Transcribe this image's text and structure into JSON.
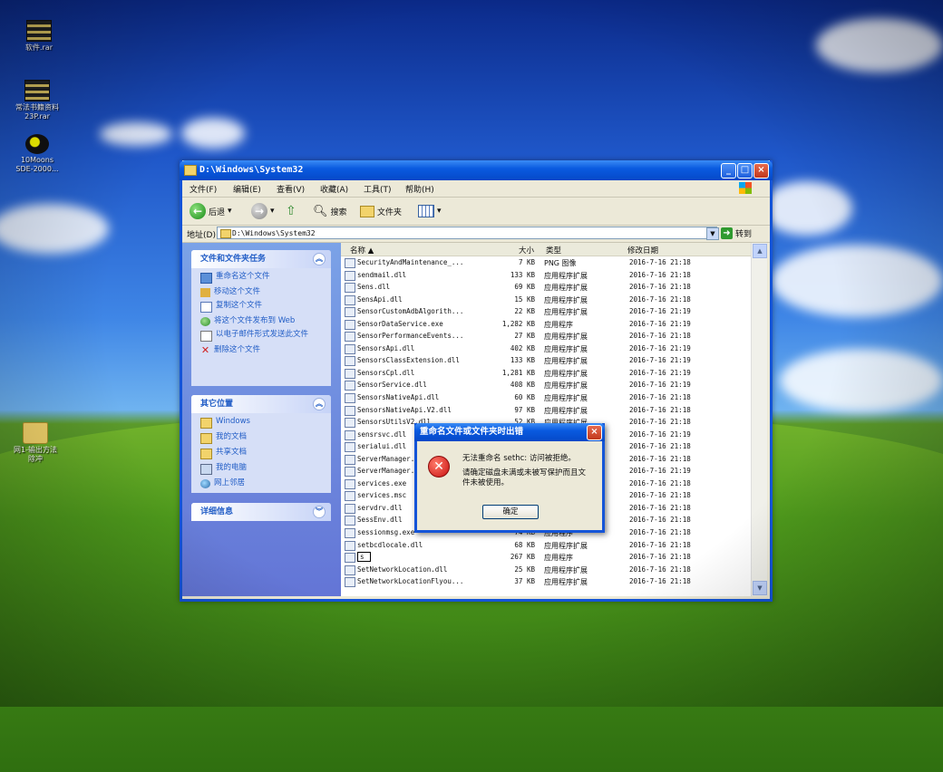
{
  "desktop": {
    "icons": [
      {
        "label": "软件.rar",
        "icon": "rar-archive-icon"
      },
      {
        "label": "常法书籍资料\n23P.rar",
        "icon": "rar-archive-icon"
      },
      {
        "label": "10Moons\nSDE-2000...",
        "icon": "app-icon"
      },
      {
        "label": "网1-输出方法\n除冲",
        "icon": "folder-icon"
      }
    ]
  },
  "window": {
    "title": "D:\\Windows\\System32",
    "menu": [
      "文件(F)",
      "编辑(E)",
      "查看(V)",
      "收藏(A)",
      "工具(T)",
      "帮助(H)"
    ],
    "toolbar": {
      "back": "后退",
      "search": "搜索",
      "folders": "文件夹"
    },
    "address": {
      "label": "地址(D)",
      "value": "D:\\Windows\\System32",
      "go": "转到"
    },
    "tasks_panel": {
      "title": "文件和文件夹任务",
      "items": [
        "重命名这个文件",
        "移动这个文件",
        "复制这个文件",
        "将这个文件发布到 Web",
        "以电子邮件形式发送此文件",
        "删除这个文件"
      ]
    },
    "places_panel": {
      "title": "其它位置",
      "items": [
        "Windows",
        "我的文档",
        "共享文档",
        "我的电脑",
        "网上邻居"
      ]
    },
    "details_panel": {
      "title": "详细信息"
    },
    "columns": {
      "name": "名称 ▲",
      "size": "大小",
      "type": "类型",
      "modified": "修改日期"
    },
    "files": [
      {
        "name": "SecurityAndMaintenance_...",
        "size": "7 KB",
        "type": "PNG 图像",
        "date": "2016-7-16 21:18"
      },
      {
        "name": "sendmail.dll",
        "size": "133 KB",
        "type": "应用程序扩展",
        "date": "2016-7-16 21:18"
      },
      {
        "name": "Sens.dll",
        "size": "69 KB",
        "type": "应用程序扩展",
        "date": "2016-7-16 21:18"
      },
      {
        "name": "SensApi.dll",
        "size": "15 KB",
        "type": "应用程序扩展",
        "date": "2016-7-16 21:18"
      },
      {
        "name": "SensorCustomAdbAlgorith...",
        "size": "22 KB",
        "type": "应用程序扩展",
        "date": "2016-7-16 21:19"
      },
      {
        "name": "SensorDataService.exe",
        "size": "1,282 KB",
        "type": "应用程序",
        "date": "2016-7-16 21:19"
      },
      {
        "name": "SensorPerformanceEvents...",
        "size": "27 KB",
        "type": "应用程序扩展",
        "date": "2016-7-16 21:18"
      },
      {
        "name": "SensorsApi.dll",
        "size": "402 KB",
        "type": "应用程序扩展",
        "date": "2016-7-16 21:19"
      },
      {
        "name": "SensorsClassExtension.dll",
        "size": "133 KB",
        "type": "应用程序扩展",
        "date": "2016-7-16 21:19"
      },
      {
        "name": "SensorsCpl.dll",
        "size": "1,281 KB",
        "type": "应用程序扩展",
        "date": "2016-7-16 21:19"
      },
      {
        "name": "SensorService.dll",
        "size": "408 KB",
        "type": "应用程序扩展",
        "date": "2016-7-16 21:19"
      },
      {
        "name": "SensorsNativeApi.dll",
        "size": "60 KB",
        "type": "应用程序扩展",
        "date": "2016-7-16 21:18"
      },
      {
        "name": "SensorsNativeApi.V2.dll",
        "size": "97 KB",
        "type": "应用程序扩展",
        "date": "2016-7-16 21:18"
      },
      {
        "name": "SensorsUtilsV2.dll",
        "size": "52 KB",
        "type": "应用程序扩展",
        "date": "2016-7-16 21:18"
      },
      {
        "name": "sensrsvc.dll",
        "size": "",
        "type": "",
        "date": "2016-7-16 21:19"
      },
      {
        "name": "serialui.dll",
        "size": "",
        "type": "",
        "date": "2016-7-16 21:18"
      },
      {
        "name": "ServerManager...",
        "size": "",
        "type": "",
        "date": "2016-7-16 21:18"
      },
      {
        "name": "ServerManager...",
        "size": "",
        "type": "",
        "date": "2016-7-16 21:19"
      },
      {
        "name": "services.exe",
        "size": "",
        "type": "",
        "date": "2016-7-16 21:18"
      },
      {
        "name": "services.msc",
        "size": "",
        "type": "",
        "date": "2016-7-16 21:18"
      },
      {
        "name": "servdrv.dll",
        "size": "",
        "type": "",
        "date": "2016-7-16 21:18"
      },
      {
        "name": "SessEnv.dll",
        "size": "",
        "type": "",
        "date": "2016-7-16 21:18"
      },
      {
        "name": "sessionmsg.exe",
        "size": "74 KB",
        "type": "应用程序",
        "date": "2016-7-16 21:18"
      },
      {
        "name": "setbcdlocale.dll",
        "size": "68 KB",
        "type": "应用程序扩展",
        "date": "2016-7-16 21:18"
      },
      {
        "name": "s",
        "size": "267 KB",
        "type": "应用程序",
        "date": "2016-7-16 21:18"
      },
      {
        "name": "SetNetworkLocation.dll",
        "size": "25 KB",
        "type": "应用程序扩展",
        "date": "2016-7-16 21:18"
      },
      {
        "name": "SetNetworkLocationFlyou...",
        "size": "37 KB",
        "type": "应用程序扩展",
        "date": "2016-7-16 21:18"
      }
    ]
  },
  "dialog": {
    "title": "重命名文件或文件夹时出错",
    "message": "无法重命名 sethc: 访问被拒绝。",
    "detail": "请确定磁盘未满或未被写保护而且文件未被使用。",
    "ok": "确定"
  },
  "colors": {
    "titlebar": "#0548c8",
    "taskpane": "#6375d6",
    "error": "#c81010"
  }
}
